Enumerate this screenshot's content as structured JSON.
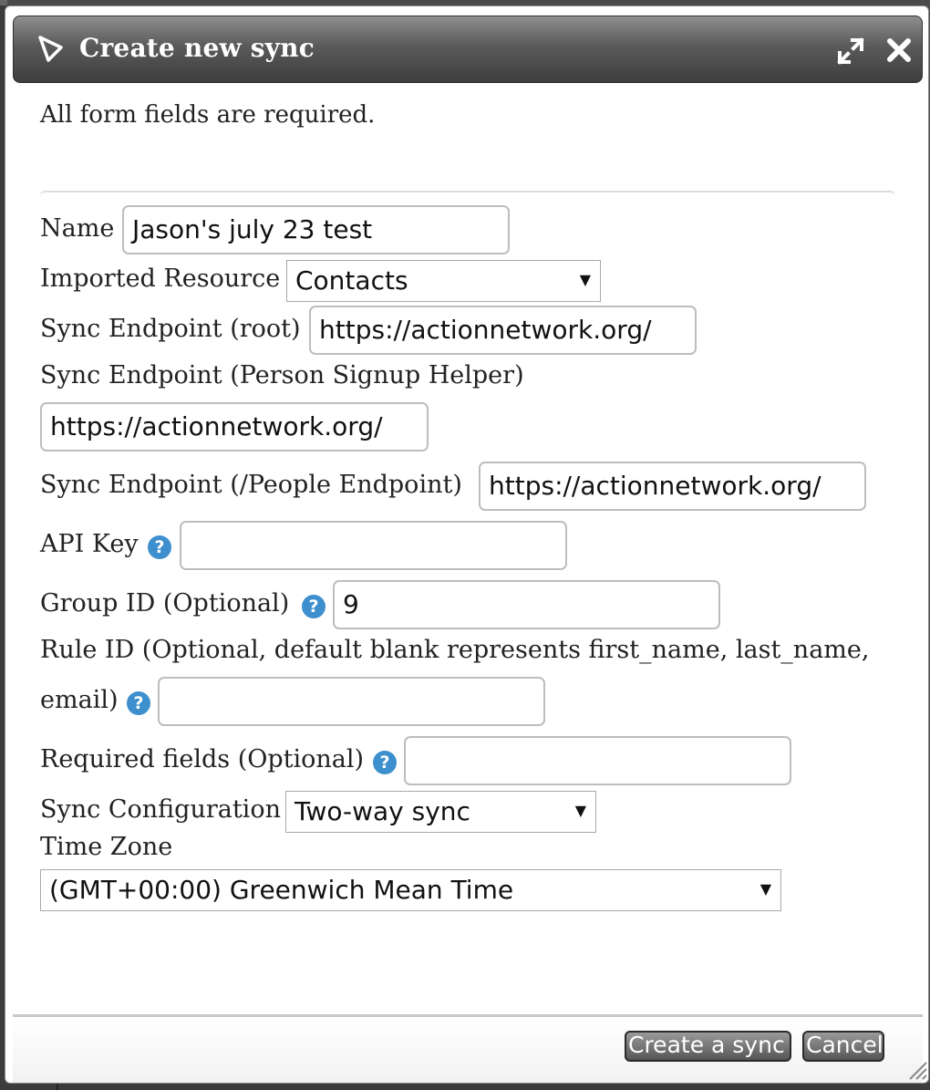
{
  "dialog": {
    "title": "Create new sync",
    "icons": {
      "title": "sync-logo-icon",
      "maximize": "expand-icon",
      "close": "close-icon"
    }
  },
  "form": {
    "intro": "All form fields are required.",
    "name": {
      "label": "Name",
      "value": "Jason's july 23 test"
    },
    "imported_resource": {
      "label": "Imported Resource",
      "selected": "Contacts"
    },
    "endpoint_root": {
      "label": "Sync Endpoint (root)",
      "value": "https://actionnetwork.org/"
    },
    "endpoint_signup": {
      "label": "Sync Endpoint (Person Signup Helper)",
      "value": "https://actionnetwork.org/"
    },
    "endpoint_people": {
      "label": "Sync Endpoint (/People Endpoint)",
      "value": "https://actionnetwork.org/"
    },
    "api_key": {
      "label": "API Key",
      "value": ""
    },
    "group_id": {
      "label": "Group ID (Optional)",
      "value": "9"
    },
    "rule_id": {
      "label_line1": "Rule ID (Optional, default blank represents first_name, last_name,",
      "label_line2": "email)",
      "value": ""
    },
    "required_fields": {
      "label": "Required fields (Optional)",
      "value": ""
    },
    "sync_config": {
      "label": "Sync Configuration",
      "selected": "Two-way sync"
    },
    "time_zone": {
      "label": "Time Zone",
      "selected": "(GMT+00:00) Greenwich Mean Time"
    },
    "help_glyph": "?",
    "dropdown_glyph": "▼"
  },
  "footer": {
    "create_label": "Create a sync",
    "cancel_label": "Cancel"
  }
}
